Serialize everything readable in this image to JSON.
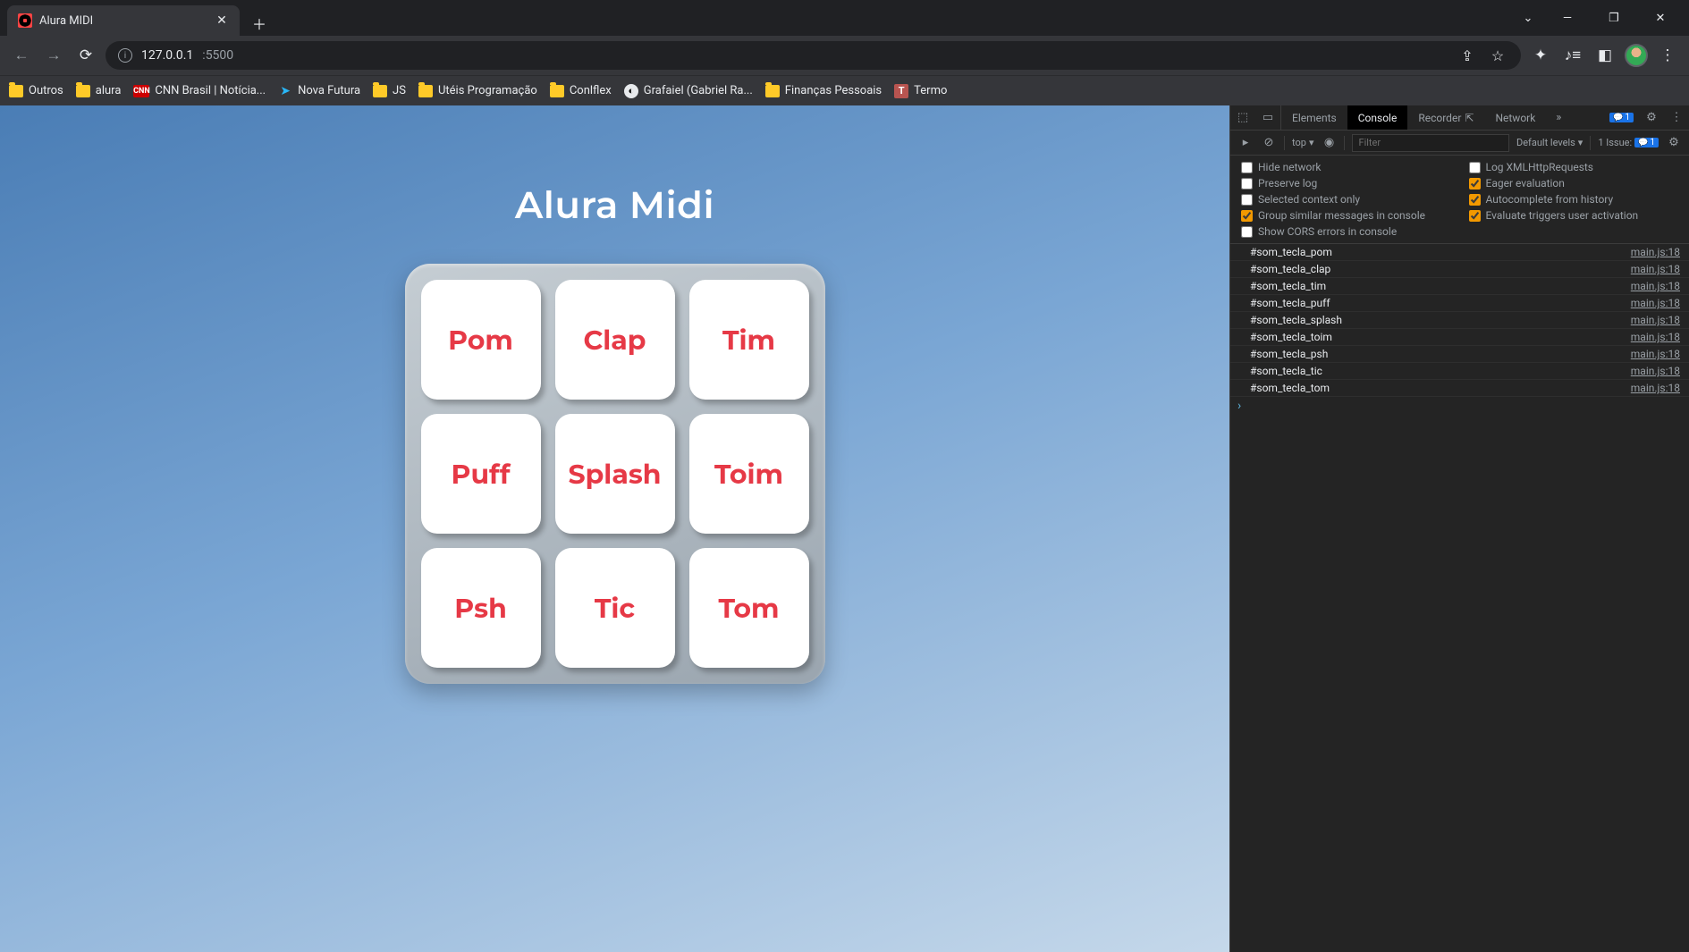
{
  "tab": {
    "title": "Alura MIDI"
  },
  "url": {
    "host": "127.0.0.1",
    "port": ":5500"
  },
  "bookmarks": {
    "outros": "Outros",
    "alura": "alura",
    "cnn": "CNN Brasil | Notícia...",
    "nova": "Nova Futura",
    "js": "JS",
    "uteis": "Utéis Programação",
    "conlflex": "Conlflex",
    "grafaiel": "Grafaiel (Gabriel Ra...",
    "financas": "Finanças Pessoais",
    "termo": "Termo"
  },
  "page": {
    "title": "Alura Midi",
    "keys": [
      "Pom",
      "Clap",
      "Tim",
      "Puff",
      "Splash",
      "Toim",
      "Psh",
      "Tic",
      "Tom"
    ]
  },
  "devtools": {
    "tabs": {
      "elements": "Elements",
      "console": "Console",
      "recorder": "Recorder",
      "network": "Network"
    },
    "messages": "1",
    "filter": {
      "top": "top",
      "placeholder": "Filter",
      "levels": "Default levels",
      "issue": "1 Issue:",
      "issueCount": "1"
    },
    "checks": {
      "hideNetwork": "Hide network",
      "logXHR": "Log XMLHttpRequests",
      "preserveLog": "Preserve log",
      "eager": "Eager evaluation",
      "selectedCtx": "Selected context only",
      "autocomplete": "Autocomplete from history",
      "groupSimilar": "Group similar messages in console",
      "evalTriggers": "Evaluate triggers user activation",
      "showCORS": "Show CORS errors in console"
    },
    "source": "main.js:18",
    "logs": [
      "#som_tecla_pom",
      "#som_tecla_clap",
      "#som_tecla_tim",
      "#som_tecla_puff",
      "#som_tecla_splash",
      "#som_tecla_toim",
      "#som_tecla_psh",
      "#som_tecla_tic",
      "#som_tecla_tom"
    ]
  }
}
